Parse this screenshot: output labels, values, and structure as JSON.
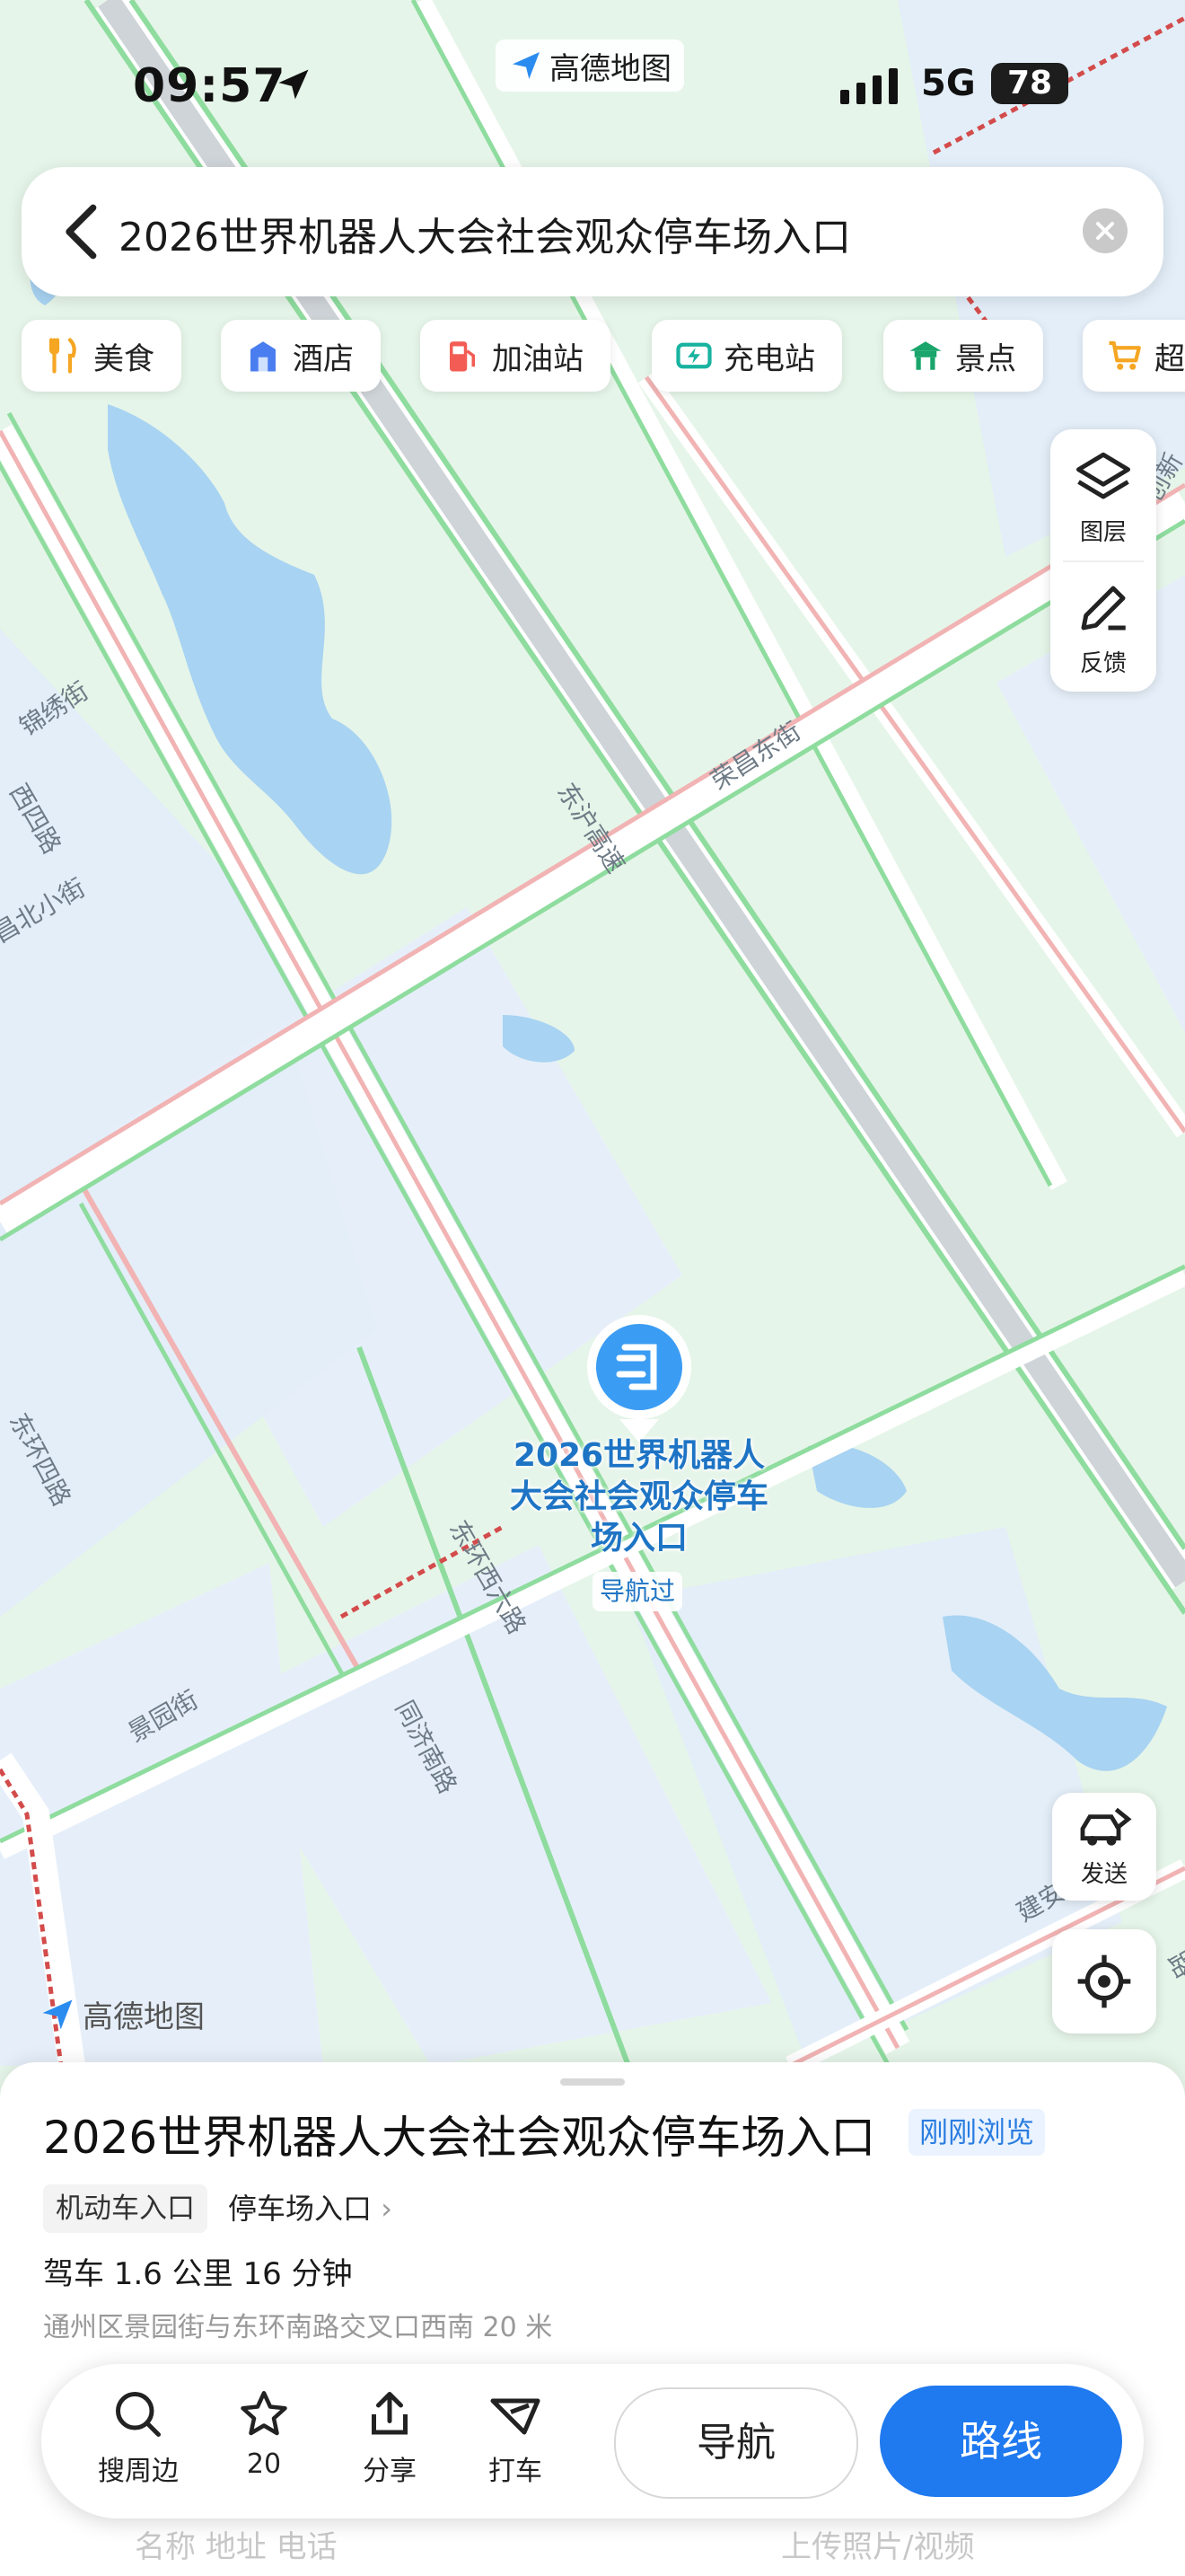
{
  "status_bar": {
    "time": "09:57",
    "app_name": "高德地图",
    "network": "5G",
    "battery": "78"
  },
  "search": {
    "query": "2026世界机器人大会社会观众停车场入口"
  },
  "categories": [
    {
      "label": "美食",
      "icon": "fork-knife-icon",
      "color": "#f5a623"
    },
    {
      "label": "酒店",
      "icon": "hotel-icon",
      "color": "#4a7ef0"
    },
    {
      "label": "加油站",
      "icon": "gas-pump-icon",
      "color": "#f25c54"
    },
    {
      "label": "充电站",
      "icon": "charging-icon",
      "color": "#18b3a0"
    },
    {
      "label": "景点",
      "icon": "pavilion-icon",
      "color": "#19a56b"
    },
    {
      "label": "超",
      "icon": "cart-icon",
      "color": "#f5a623"
    }
  ],
  "map_tools": {
    "layers_label": "图层",
    "feedback_label": "反馈",
    "send_label": "发送"
  },
  "map_labels": {
    "road_1": "东沪高速",
    "road_2": "荣昌东街",
    "road_3": "锦绣街",
    "road_4": "西四路",
    "road_5": "昌北小街",
    "road_6": "东环西六路",
    "road_7": "景园街",
    "road_8": "同济南路",
    "road_9": "东环四路",
    "road_10": "建安",
    "road_11": "路",
    "road_12": "创新"
  },
  "marker": {
    "name": "2026世界机器人大会社会观众停车场入口",
    "tag": "导航过"
  },
  "watermark": "高德地图",
  "poi": {
    "title": "2026世界机器人大会社会观众停车场入口",
    "badge": "刚刚浏览",
    "tag": "机动车入口",
    "category": "停车场入口",
    "drive_info": "驾车 1.6 公里 16 分钟",
    "address": "通州区景园街与东环南路交叉口西南 20 米",
    "behind_left": "名称 地址 电话",
    "behind_right": "上传照片/视频"
  },
  "actions": {
    "search_nearby": "搜周边",
    "favorites_count": "20",
    "share": "分享",
    "taxi": "打车",
    "navigate": "导航",
    "route": "路线"
  }
}
